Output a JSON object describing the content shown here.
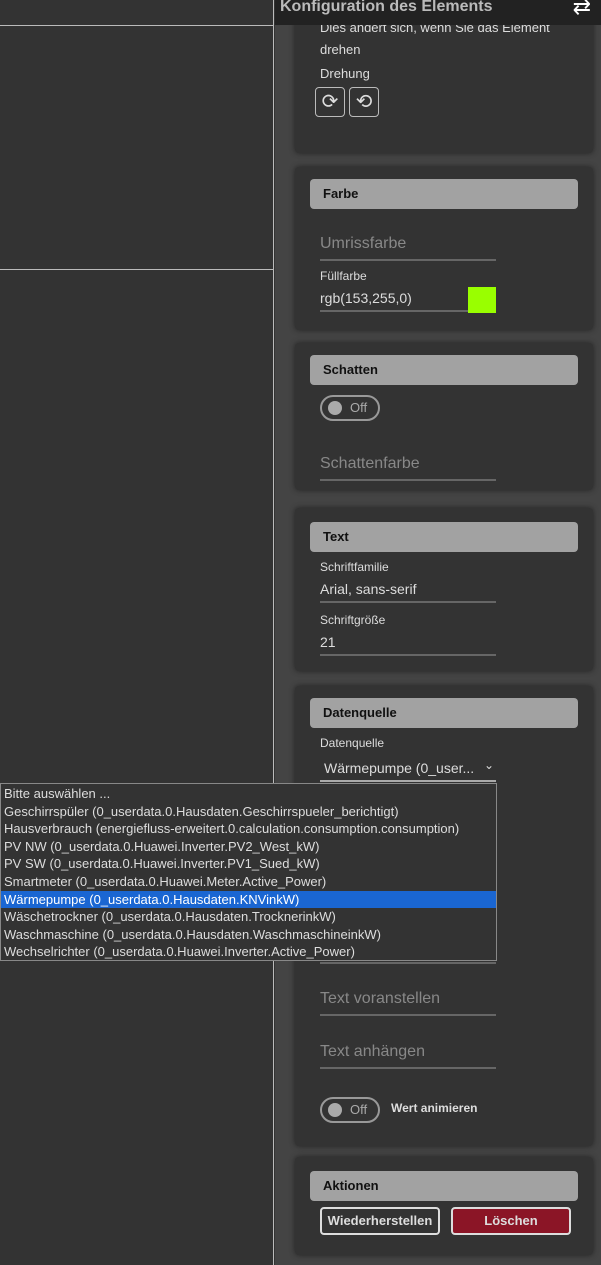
{
  "header": {
    "title": "Konfiguration des Elements",
    "swap_icon": "swap-arrows-icon"
  },
  "rotation": {
    "hint": "Dies ändert sich, wenn Sie das Element drehen",
    "label": "Drehung",
    "rotate_cw": "⟳",
    "rotate_ccw": "⟲"
  },
  "color": {
    "title": "Farbe",
    "outline_placeholder": "Umrissfarbe",
    "fill_label": "Füllfarbe",
    "fill_value": "rgb(153,255,0)",
    "fill_swatch": "#99ff00"
  },
  "shadow": {
    "title": "Schatten",
    "toggle": "Off",
    "color_placeholder": "Schattenfarbe"
  },
  "text": {
    "title": "Text",
    "font_family_label": "Schriftfamilie",
    "font_family_value": "Arial, sans-serif",
    "font_size_label": "Schriftgröße",
    "font_size_value": "21"
  },
  "datasource": {
    "title": "Datenquelle",
    "label": "Datenquelle",
    "selected": "Wärmepumpe (0_user...",
    "options": [
      "Bitte auswählen ...",
      "Geschirrspüler (0_userdata.0.Hausdaten.Geschirrspueler_berichtigt)",
      "Hausverbrauch (energiefluss-erweitert.0.calculation.consumption.consumption)",
      "PV NW (0_userdata.0.Huawei.Inverter.PV2_West_kW)",
      "PV SW (0_userdata.0.Huawei.Inverter.PV1_Sued_kW)",
      "Smartmeter (0_userdata.0.Huawei.Meter.Active_Power)",
      "Wärmepumpe (0_userdata.0.Hausdaten.KNVinkW)",
      "Wäschetrockner (0_userdata.0.Hausdaten.TrocknerinkW)",
      "Waschmaschine (0_userdata.0.Hausdaten.WaschmaschineinkW)",
      "Wechselrichter (0_userdata.0.Huawei.Inverter.Active_Power)"
    ],
    "selected_index": 6,
    "prepend_placeholder": "Text voranstellen",
    "append_placeholder": "Text anhängen",
    "animate_toggle": "Off",
    "animate_label": "Wert animieren"
  },
  "actions": {
    "title": "Aktionen",
    "restore": "Wiederherstellen",
    "delete": "Löschen",
    "delete_color": "#8b1526"
  }
}
